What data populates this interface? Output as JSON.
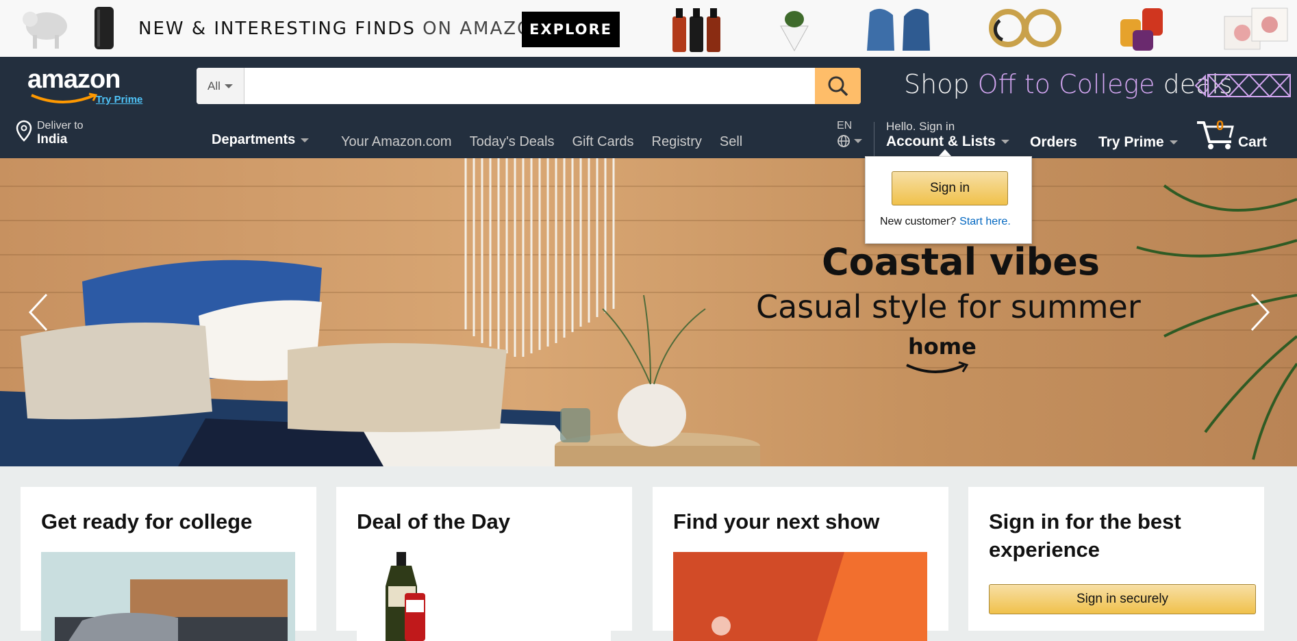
{
  "promo": {
    "text_bold": "NEW & INTERESTING FINDS",
    "text_light": "ON AMAZON",
    "button": "EXPLORE"
  },
  "nav": {
    "logo": "amazon",
    "try_prime_link": "Try Prime",
    "search": {
      "category": "All",
      "placeholder": ""
    },
    "swm": {
      "pre": "Shop ",
      "highlight": "Off to College",
      "post": " deals"
    },
    "deliver": {
      "line1": "Deliver to",
      "line2": "India"
    },
    "departments": "Departments",
    "links": [
      "Your Amazon.com",
      "Today's Deals",
      "Gift Cards",
      "Registry",
      "Sell"
    ],
    "lang": "EN",
    "account": {
      "line1": "Hello. Sign in",
      "line2": "Account & Lists"
    },
    "orders": "Orders",
    "try_prime": "Try Prime",
    "cart": {
      "count": "0",
      "label": "Cart"
    }
  },
  "flyout": {
    "sign_in": "Sign in",
    "new_customer": "New customer?",
    "start_here": "Start here."
  },
  "hero": {
    "title": "Coastal vibes",
    "subtitle": "Casual style for summer",
    "brand": "home"
  },
  "cards": [
    {
      "title": "Get ready for college"
    },
    {
      "title": "Deal of the Day"
    },
    {
      "title": "Find your next show"
    },
    {
      "title": "Sign in for the best experience",
      "button": "Sign in securely"
    }
  ],
  "colors": {
    "nav_bg": "#232f3e",
    "search_btn": "#febd69",
    "button_gold": "#f0c14b",
    "link_blue": "#0066c0",
    "cart_orange": "#f08804"
  }
}
